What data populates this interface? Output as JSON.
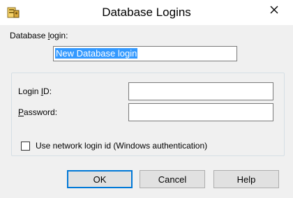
{
  "window": {
    "title": "Database Logins",
    "app_icon": "database-logins-icon",
    "close_icon": "close-icon"
  },
  "database_login": {
    "label": "Database login:",
    "value": "New Database login"
  },
  "credentials": {
    "login_id_label": "Login ID:",
    "login_id_value": "",
    "password_label": "Password:",
    "password_value": ""
  },
  "network_login": {
    "label": "Use network login id (Windows authentication)",
    "checked": false
  },
  "buttons": {
    "ok": "OK",
    "cancel": "Cancel",
    "help": "Help"
  },
  "colors": {
    "selection": "#3399ff",
    "default_button_border": "#0078d7"
  }
}
